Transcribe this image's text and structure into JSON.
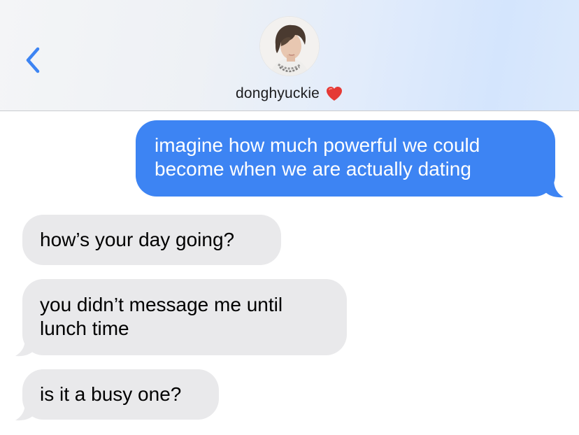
{
  "header": {
    "contact_name": "donghyuckie",
    "heart_icon": "red-heart-emoji",
    "back_icon": "chevron-left-icon",
    "accent_color": "#3d84f3"
  },
  "messages": [
    {
      "direction": "outgoing",
      "line1": "imagine how much powerful we could",
      "line2": "become when we are actually dating"
    },
    {
      "direction": "incoming",
      "line1": "how’s your day going?"
    },
    {
      "direction": "incoming",
      "line1": "you didn’t message me until",
      "line2": "lunch time"
    },
    {
      "direction": "incoming",
      "line1": "is it a busy one?"
    }
  ]
}
